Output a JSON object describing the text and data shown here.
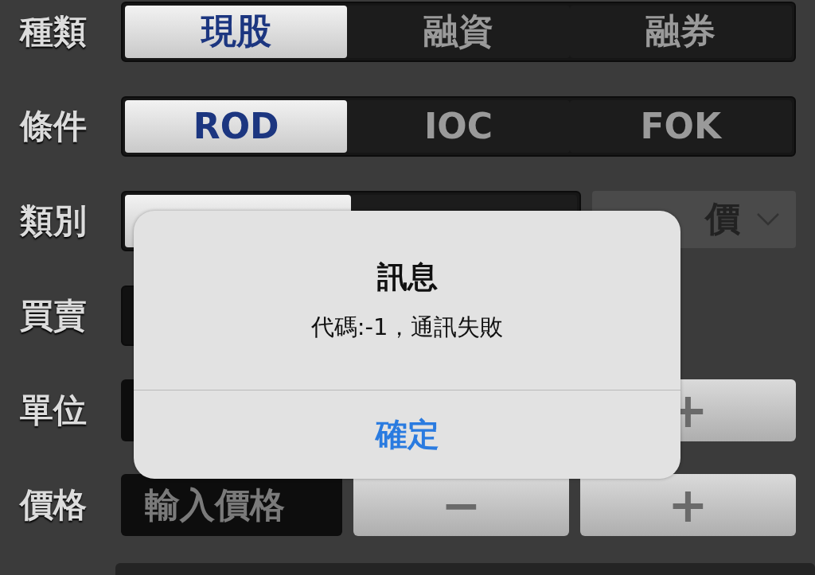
{
  "rows": [
    {
      "label": "種類",
      "kind": "segmented",
      "options": [
        {
          "label": "現股",
          "selected": true
        },
        {
          "label": "融資",
          "selected": false
        },
        {
          "label": "融券",
          "selected": false
        }
      ]
    },
    {
      "label": "條件",
      "kind": "segmented",
      "options": [
        {
          "label": "ROD",
          "selected": true
        },
        {
          "label": "IOC",
          "selected": false
        },
        {
          "label": "FOK",
          "selected": false
        }
      ]
    },
    {
      "label": "類別",
      "kind": "segmented_dropdown",
      "options": [
        {
          "selected": true
        },
        {
          "selected": false
        }
      ],
      "dropdown": {
        "value": "價"
      }
    },
    {
      "label": "買賣",
      "kind": "field"
    },
    {
      "label": "單位",
      "kind": "stepper",
      "plus": "+"
    },
    {
      "label": "價格",
      "kind": "stepper",
      "placeholder": "輸入價格",
      "minus": "−",
      "plus": "+"
    }
  ],
  "dialog": {
    "title": "訊息",
    "message": "代碼:-1，通訊失敗",
    "button": "確定"
  }
}
